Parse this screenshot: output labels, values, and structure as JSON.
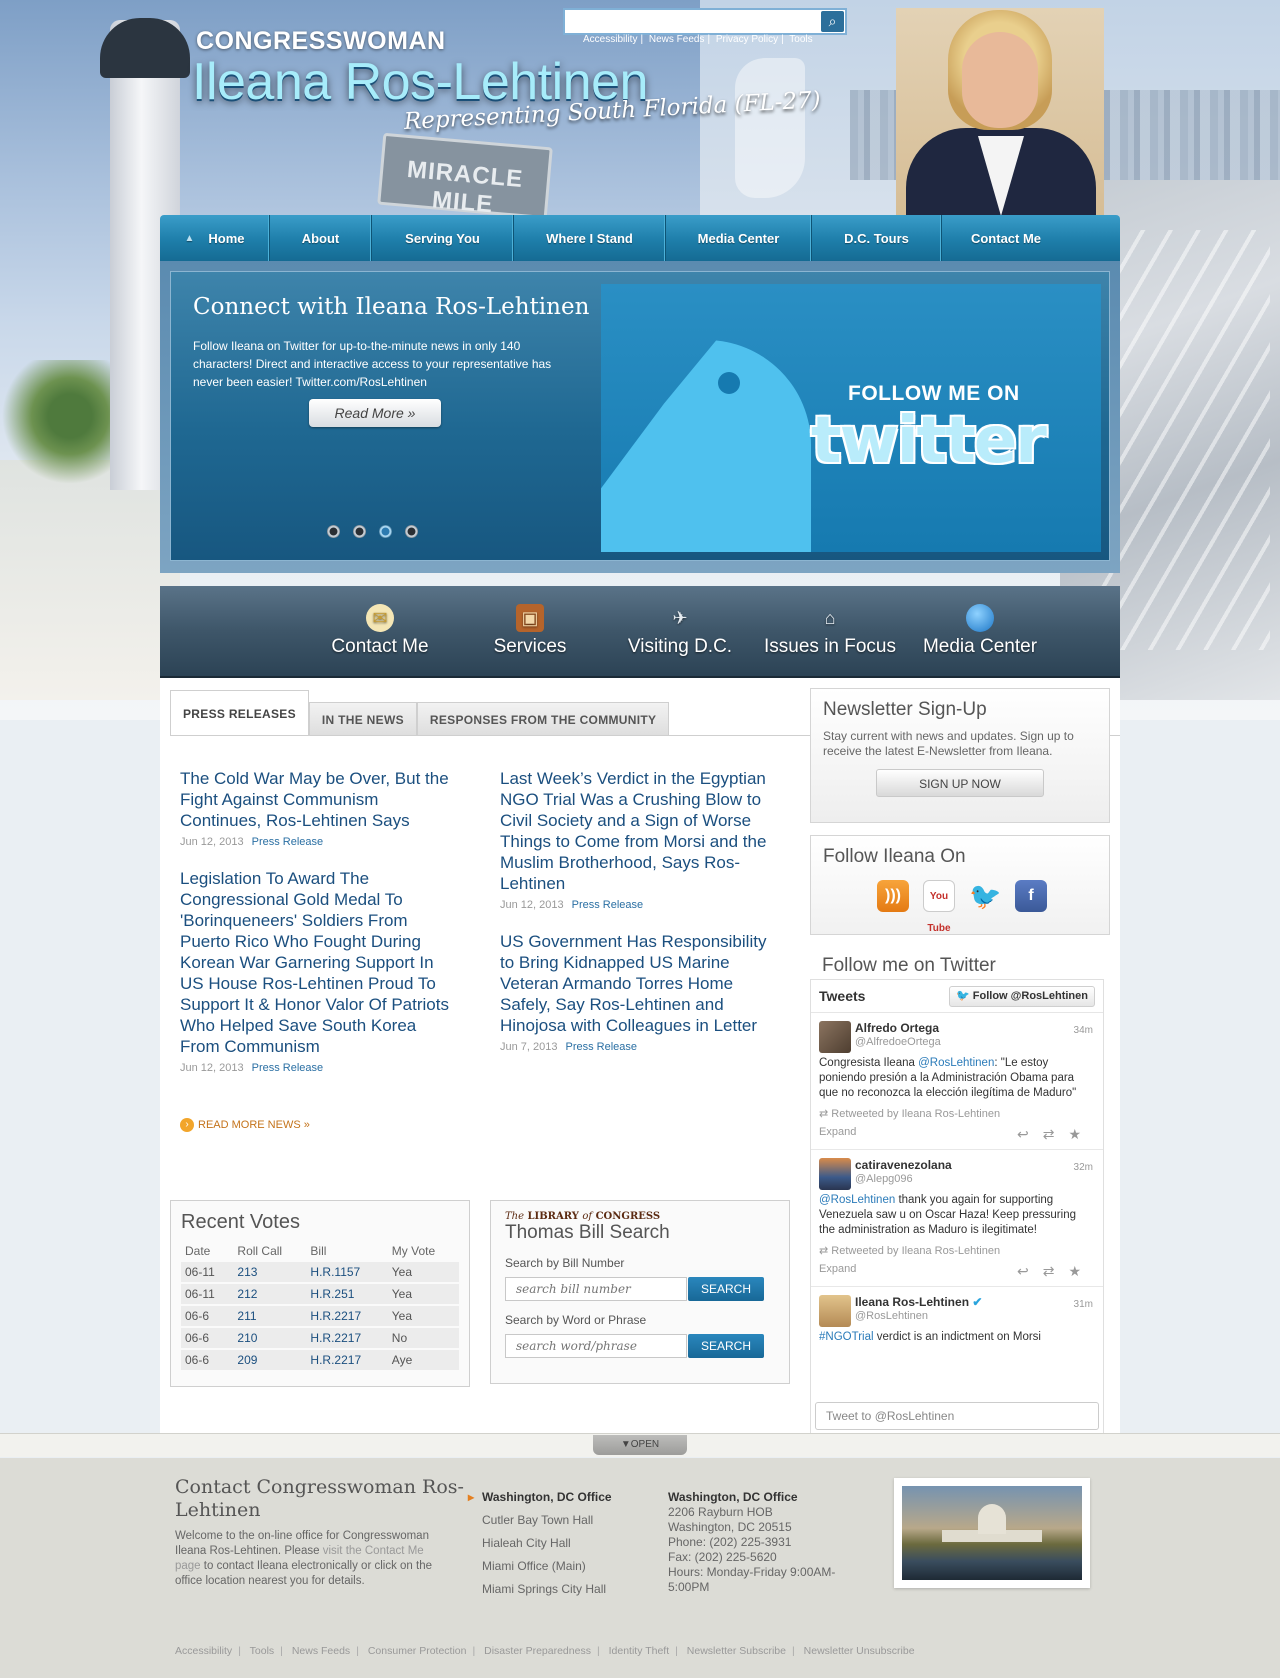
{
  "header": {
    "search_placeholder": "",
    "search_icon": "search-icon",
    "util_links": [
      "Accessibility",
      "News Feeds",
      "Privacy Policy",
      "Tools"
    ],
    "title_prefix": "CONGRESSWOMAN",
    "title_name": "Ileana Ros-Lehtinen",
    "title_tagline": "Representing South Florida (FL-27)",
    "street_sign": "MIRACLE MILE"
  },
  "nav": {
    "items": [
      "Home",
      "About",
      "Serving You",
      "Where I Stand",
      "Media Center",
      "D.C. Tours",
      "Contact Me"
    ]
  },
  "slider": {
    "title": "Connect with Ileana Ros-Lehtinen",
    "text": "Follow Ileana on Twitter for up-to-the-minute news in only 140 characters! Direct and interactive access to your representative has never been easier! Twitter.com/RosLehtinen",
    "button": "Read More »",
    "panel_follow": "FOLLOW ME ON",
    "panel_brand": "twitter",
    "active_dot": 3
  },
  "quicklinks": [
    {
      "label": "Contact Me",
      "icon": "envelope-icon"
    },
    {
      "label": "Services",
      "icon": "briefcase-icon"
    },
    {
      "label": "Visiting D.C.",
      "icon": "airplane-icon"
    },
    {
      "label": "Issues in Focus",
      "icon": "capitol-icon"
    },
    {
      "label": "Media Center",
      "icon": "globe-icon"
    }
  ],
  "tabs": [
    "PRESS RELEASES",
    "IN THE NEWS",
    "RESPONSES FROM THE COMMUNITY"
  ],
  "news": {
    "left": [
      {
        "title": "The Cold War May be Over, But the Fight Against Communism Continues, Ros-Lehtinen Says",
        "date": "Jun 12, 2013",
        "tag": "Press Release"
      },
      {
        "title": "Legislation To Award The Congressional Gold Medal To 'Borinqueneers' Soldiers From Puerto Rico Who Fought During Korean War Garnering Support In US House Ros-Lehtinen Proud To Support It & Honor Valor Of Patriots Who Helped Save South Korea From Communism",
        "date": "Jun 12, 2013",
        "tag": "Press Release"
      }
    ],
    "right": [
      {
        "title": "Last Week’s Verdict in the Egyptian NGO Trial Was a Crushing Blow to Civil Society and a Sign of Worse Things to Come from Morsi and the Muslim Brotherhood, Says Ros-Lehtinen",
        "date": "Jun 12, 2013",
        "tag": "Press Release"
      },
      {
        "title": "US Government Has Responsibility to Bring Kidnapped US Marine Veteran Armando Torres Home Safely, Say Ros-Lehtinen and Hinojosa with Colleagues in Letter",
        "date": "Jun 7, 2013",
        "tag": "Press Release"
      }
    ],
    "more": "READ MORE NEWS »"
  },
  "votes": {
    "title": "Recent Votes",
    "headers": [
      "Date",
      "Roll Call",
      "Bill",
      "My Vote"
    ],
    "rows": [
      [
        "06-11",
        "213",
        "H.R.1157",
        "Yea"
      ],
      [
        "06-11",
        "212",
        "H.R.251",
        "Yea"
      ],
      [
        "06-6",
        "211",
        "H.R.2217",
        "Yea"
      ],
      [
        "06-6",
        "210",
        "H.R.2217",
        "No"
      ],
      [
        "06-6",
        "209",
        "H.R.2217",
        "Aye"
      ]
    ]
  },
  "thomas": {
    "loc_the": "The",
    "loc_library": "LIBRARY",
    "loc_of": "of",
    "loc_congress": "CONGRESS",
    "title": "Thomas Bill Search",
    "label1": "Search by Bill Number",
    "placeholder1": "search bill number",
    "label2": "Search by Word or Phrase",
    "placeholder2": "search word/phrase",
    "button": "SEARCH"
  },
  "sidebar": {
    "newsletter_title": "Newsletter Sign-Up",
    "newsletter_desc": "Stay current with news and updates. Sign up to receive the latest E-Newsletter from Ileana.",
    "signup": "SIGN UP NOW",
    "follow_title": "Follow Ileana On",
    "social": [
      {
        "name": "rss-icon",
        "glyph": ")))"
      },
      {
        "name": "youtube-icon",
        "glyph": "You Tube"
      },
      {
        "name": "twitter-icon",
        "glyph": "🐦"
      },
      {
        "name": "facebook-icon",
        "glyph": "f"
      }
    ],
    "twitter_title": "Follow me on Twitter",
    "widget_label": "Tweets",
    "widget_follow": "Follow @RosLehtinen",
    "tweets": [
      {
        "name": "Alfredo Ortega",
        "handle": "@AlfredoeOrtega",
        "time": "34m",
        "pre": "Congresista Ileana ",
        "mention": "@RosLehtinen",
        "post": ": \"Le estoy poniendo presión a la Administración Obama para que no reconozca la elección ilegítima de Maduro\"",
        "rt": "Retweeted by Ileana Ros-Lehtinen",
        "expand": "Expand",
        "avatar": "#6a5a4a"
      },
      {
        "name": "catiravenezolana",
        "handle": "@Alepg096",
        "time": "32m",
        "pre": "",
        "mention": "@RosLehtinen",
        "post": " thank you again for supporting Venezuela saw u on Oscar Haza! Keep pressuring the administration as Maduro is ilegitimate!",
        "rt": "Retweeted by Ileana Ros-Lehtinen",
        "expand": "Expand",
        "avatar": "#3c5a8a"
      },
      {
        "name": "Ileana Ros-Lehtinen",
        "handle": "@RosLehtinen",
        "time": "31m",
        "pre": "",
        "mention": "#NGOTrial",
        "post": " verdict is an indictment on Morsi",
        "rt": "",
        "expand": "",
        "avatar": "#d4b07a"
      }
    ],
    "compose": "Tweet to @RosLehtinen"
  },
  "footer": {
    "open": "OPEN",
    "title": "Contact Congresswoman Ros-Lehtinen",
    "desc_pre": "Welcome to the on-line office for Congresswoman Ileana Ros-Lehtinen. Please ",
    "desc_link": "visit the Contact Me page",
    "desc_post": " to contact Ileana electronically or click on the office location nearest you for details.",
    "offices": [
      "Washington, DC Office",
      "Cutler Bay Town Hall",
      "Hialeah City Hall",
      "Miami Office (Main)",
      "Miami Springs City Hall"
    ],
    "addr_title": "Washington, DC Office",
    "addr_lines": [
      "2206 Rayburn HOB",
      "Washington, DC 20515",
      "Phone: (202) 225-3931",
      "Fax: (202) 225-5620",
      "Hours: Monday-Friday 9:00AM-5:00PM"
    ],
    "links": [
      "Accessibility",
      "Tools",
      "News Feeds",
      "Consumer Protection",
      "Disaster Preparedness",
      "Identity Theft",
      "Newsletter Subscribe",
      "Newsletter Unsubscribe"
    ]
  }
}
